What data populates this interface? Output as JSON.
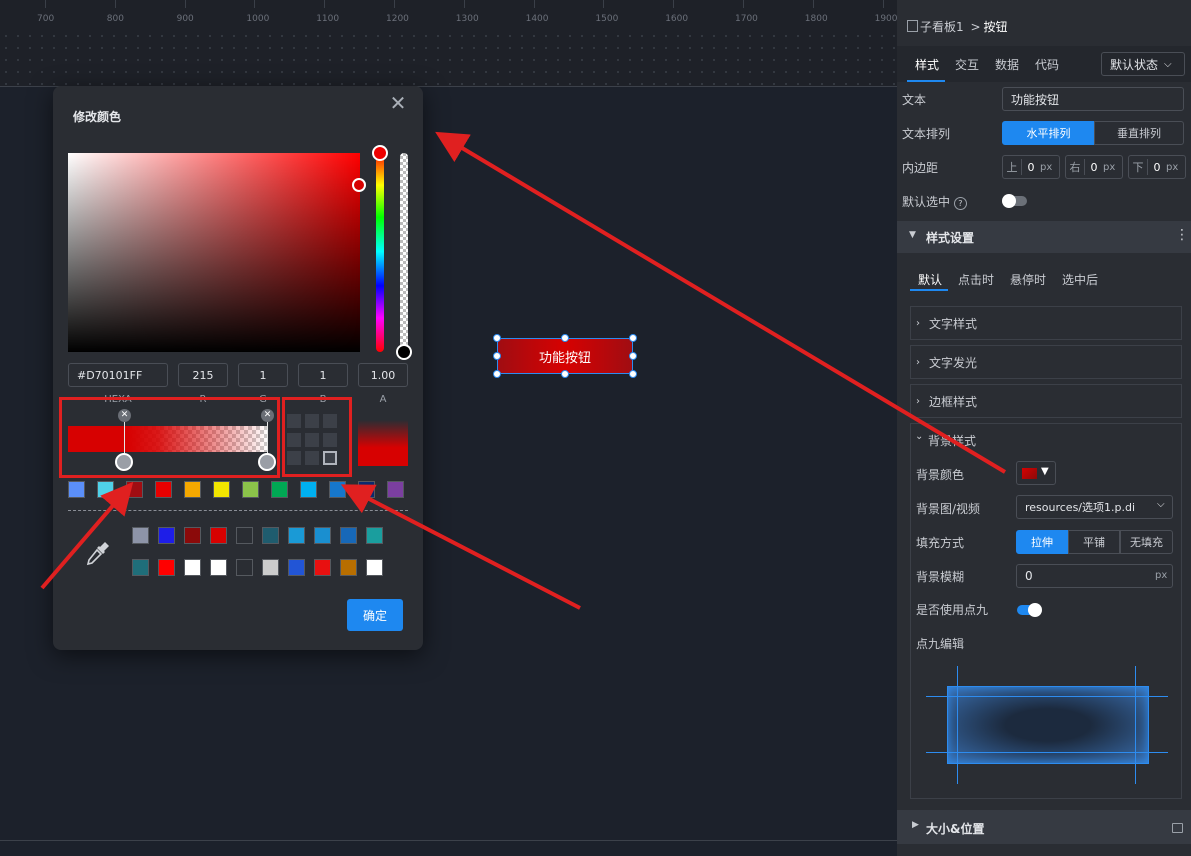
{
  "ruler": {
    "ticks": [
      "700",
      "800",
      "900",
      "1000",
      "1100",
      "1200",
      "1300",
      "1400",
      "1500",
      "1600",
      "1700",
      "1800",
      "1900"
    ]
  },
  "canvas": {
    "component_label": "功能按钮"
  },
  "dialog": {
    "title": "修改颜色",
    "hex_value": "#D70101FF",
    "r": "215",
    "g": "1",
    "b": "1",
    "a": "1.00",
    "label_hex": "HEXA",
    "label_r": "R",
    "label_g": "G",
    "label_b": "B",
    "label_a": "A",
    "ok_label": "确定",
    "current_color": "#D70101",
    "preset_colors": [
      "#5b8ff9",
      "#4fd1e8",
      "#a00d12",
      "#e80000",
      "#f5a800",
      "#f2e600",
      "#8bc34a",
      "#00a854",
      "#00b0f0",
      "#1677cc",
      "#0a2a6e",
      "#7b3fa0"
    ],
    "recent_row1": [
      "#8d94a8",
      "#1e1ee8",
      "#8b0a0a",
      "#d70101",
      "#2a2d33",
      "#1f5c6e",
      "#1a9ad6",
      "#1a8fd0",
      "#1768b8",
      "#1a9e9e"
    ],
    "recent_row2": [
      "#1f6e7a",
      "#ff0000",
      "#ffffff",
      "#ffffff",
      "#2a2d33",
      "#cccccc",
      "#2255d6",
      "#e81010",
      "#b86e00",
      "#ffffff"
    ]
  },
  "panel": {
    "breadcrumb_parent": "子看板1",
    "breadcrumb_sep": ">",
    "breadcrumb_current": "按钮",
    "tabs": [
      "样式",
      "交互",
      "数据",
      "代码"
    ],
    "state_dropdown": "默认状态",
    "text_label": "文本",
    "text_value": "功能按钮",
    "text_layout_label": "文本排列",
    "text_layout_options": [
      "水平排列",
      "垂直排列"
    ],
    "padding_label": "内边距",
    "padding": [
      {
        "dir": "上",
        "value": "0",
        "unit": "px"
      },
      {
        "dir": "右",
        "value": "0",
        "unit": "px"
      },
      {
        "dir": "下",
        "value": "0",
        "unit": "px"
      }
    ],
    "default_selected_label": "默认选中",
    "style_section_title": "样式设置",
    "state_tabs": [
      "默认",
      "点击时",
      "悬停时",
      "选中后"
    ],
    "groups": [
      "文字样式",
      "文字发光",
      "边框样式",
      "背景样式"
    ],
    "bg_color_label": "背景颜色",
    "bg_image_label": "背景图/视频",
    "bg_image_value": "resources/选项1.p.di",
    "fill_label": "填充方式",
    "fill_options": [
      "拉伸",
      "平铺",
      "无填充"
    ],
    "blur_label": "背景模糊",
    "blur_value": "0",
    "blur_unit": "px",
    "nine_label": "是否使用点九",
    "nine_edit_label": "点九编辑",
    "size_section_title": "大小&位置"
  }
}
